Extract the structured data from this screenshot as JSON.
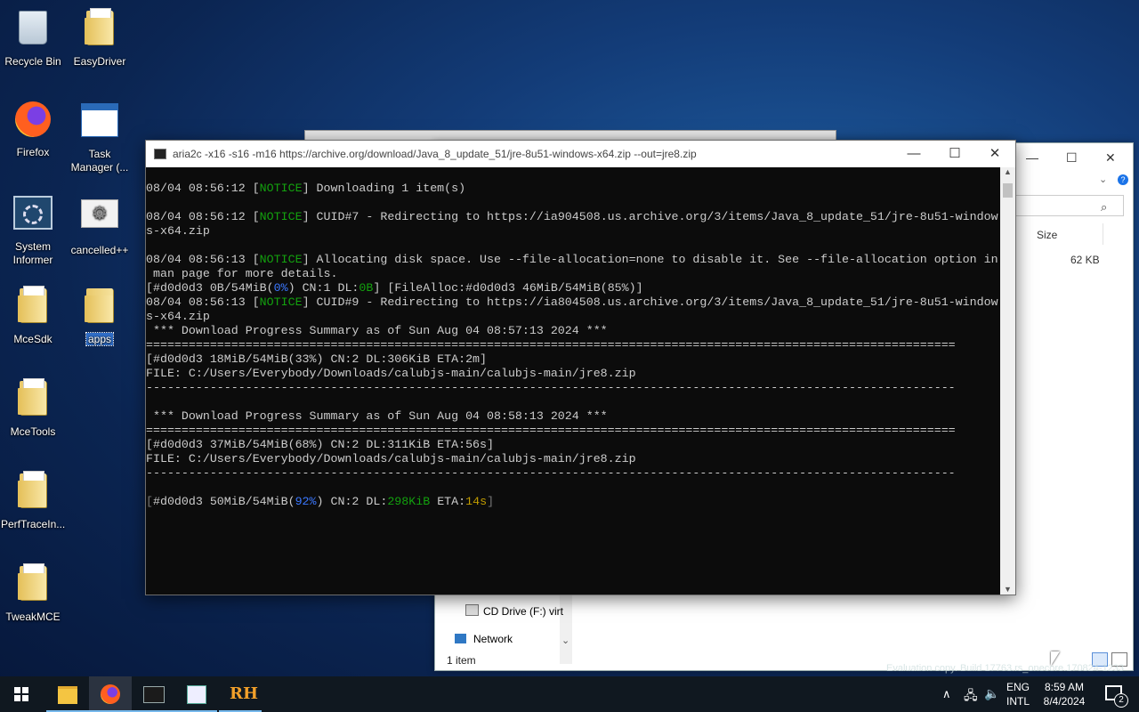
{
  "desktop": {
    "icons": [
      {
        "label": "Recycle Bin",
        "icon": "recycle-bin-icon"
      },
      {
        "label": "EasyDriver",
        "icon": "folder-icon"
      },
      {
        "label": "Firefox",
        "icon": "firefox-icon"
      },
      {
        "label": "Task Manager (...",
        "icon": "task-manager-icon"
      },
      {
        "label": "System Informer",
        "icon": "system-informer-icon"
      },
      {
        "label": "cancelled++",
        "icon": "settings-icon"
      },
      {
        "label": "MceSdk",
        "icon": "folder-icon"
      },
      {
        "label": "apps",
        "icon": "folder-icon"
      },
      {
        "label": "MceTools",
        "icon": "folder-icon"
      },
      {
        "label": "PerfTraceIn...",
        "icon": "folder-icon"
      },
      {
        "label": "TweakMCE",
        "icon": "folder-icon"
      }
    ]
  },
  "explorer": {
    "size_header": "Size",
    "size_value": "62 KB",
    "nav_cd": "CD Drive (F:) virt",
    "nav_network": "Network",
    "status": "1 item"
  },
  "console": {
    "title": "aria2c  -x16 -s16 -m16 https://archive.org/download/Java_8_update_51/jre-8u51-windows-x64.zip --out=jre8.zip",
    "lines": [
      {
        "a": "08/04 08:56:12 [",
        "g": "NOTICE",
        "b": "] Downloading 1 item(s)"
      },
      {
        "a": ""
      },
      {
        "a": "08/04 08:56:12 [",
        "g": "NOTICE",
        "b": "] CUID#7 - Redirecting to https://ia904508.us.archive.org/3/items/Java_8_update_51/jre-8u51-window"
      },
      {
        "a": "s-x64.zip"
      },
      {
        "a": ""
      },
      {
        "a": "08/04 08:56:13 [",
        "g": "NOTICE",
        "b": "] Allocating disk space. Use --file-allocation=none to disable it. See --file-allocation option in"
      },
      {
        "a": " man page for more details."
      },
      {
        "a": "[#d0d0d3 0B/54MiB(",
        "bl": "0%",
        "b": ") CN:1 DL:",
        "g2": "0B",
        "c": "] [FileAlloc:#d0d0d3 46MiB/54MiB(85%)]"
      },
      {
        "a": "08/04 08:56:13 [",
        "g": "NOTICE",
        "b": "] CUID#9 - Redirecting to https://ia804508.us.archive.org/3/items/Java_8_update_51/jre-8u51-window"
      },
      {
        "a": "s-x64.zip"
      },
      {
        "a": " *** Download Progress Summary as of Sun Aug 04 08:57:13 2024 ***"
      },
      {
        "a": "=================================================================================================================="
      },
      {
        "a": "[#d0d0d3 18MiB/54MiB(33%) CN:2 DL:306KiB ETA:2m]"
      },
      {
        "a": "FILE: C:/Users/Everybody/Downloads/calubjs-main/calubjs-main/jre8.zip"
      },
      {
        "a": "------------------------------------------------------------------------------------------------------------------"
      },
      {
        "a": ""
      },
      {
        "a": " *** Download Progress Summary as of Sun Aug 04 08:58:13 2024 ***"
      },
      {
        "a": "=================================================================================================================="
      },
      {
        "a": "[#d0d0d3 37MiB/54MiB(68%) CN:2 DL:311KiB ETA:56s]"
      },
      {
        "a": "FILE: C:/Users/Everybody/Downloads/calubjs-main/calubjs-main/jre8.zip"
      },
      {
        "a": "------------------------------------------------------------------------------------------------------------------"
      },
      {
        "a": ""
      },
      {
        "a": "",
        "progress": true
      }
    ],
    "progress": {
      "open": "[",
      "main": "#d0d0d3 50MiB/54MiB(",
      "pct": "92%",
      "mid": ") CN:2 DL:",
      "dl": "298KiB",
      "eta_label": " ETA:",
      "eta": "14s",
      "close": "]"
    }
  },
  "watermark": "Evaluation copy. Build 17763.rs_onecore.170824-1233",
  "taskbar": {
    "apps": [
      "file-explorer-icon",
      "firefox-icon",
      "terminal-icon",
      "notepad-icon",
      "rh-icon"
    ],
    "lang1": "ENG",
    "lang2": "INTL",
    "time": "8:59 AM",
    "date": "8/4/2024",
    "notifications": "2"
  },
  "colors": {
    "notice": "#13a10e",
    "percent": "#3b78ff",
    "eta": "#c19c00",
    "accent": "#76b9ed"
  }
}
